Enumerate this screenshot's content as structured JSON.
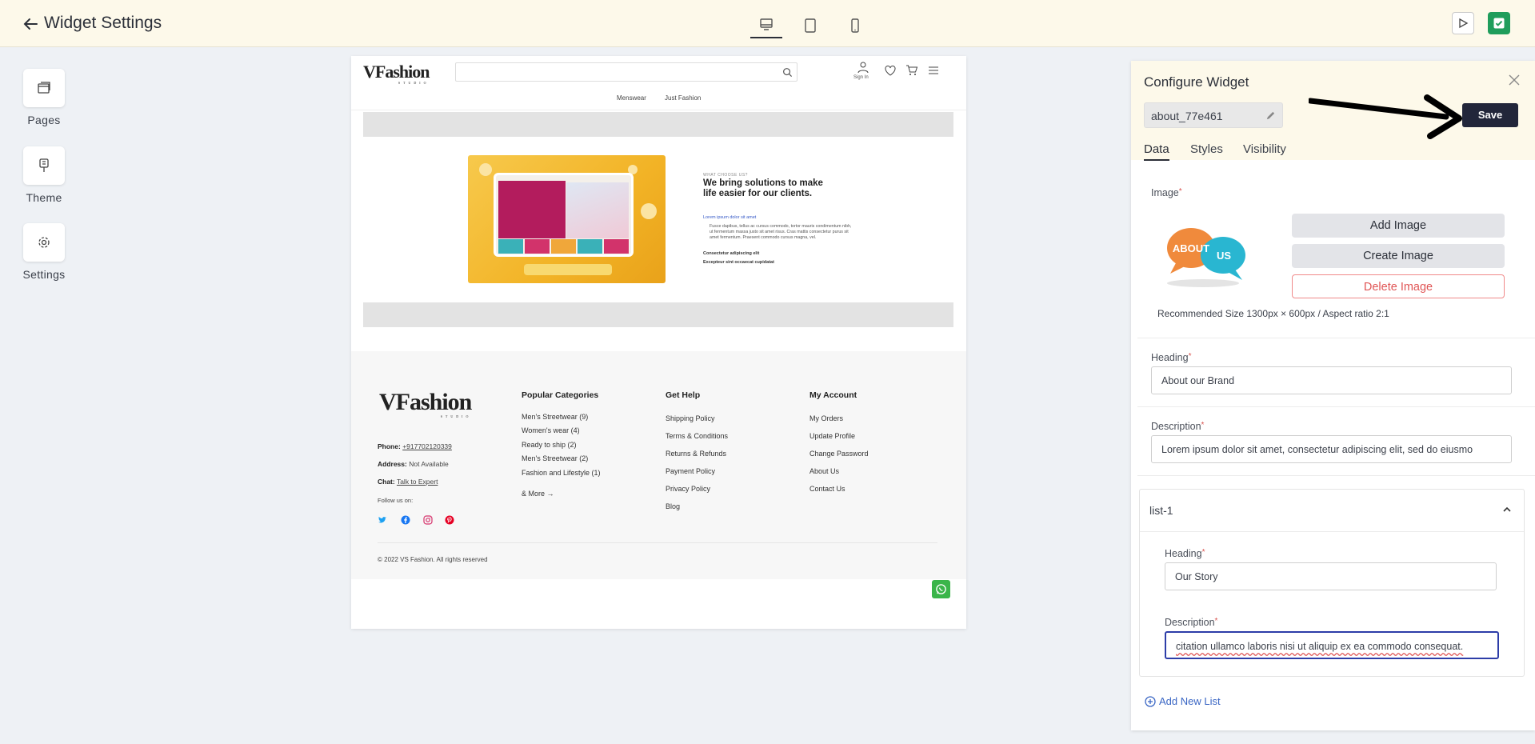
{
  "topbar": {
    "title": "Widget Settings",
    "devices": [
      "desktop-icon",
      "tablet-icon",
      "mobile-icon"
    ],
    "active_device": "desktop"
  },
  "rail": [
    {
      "label": "Pages",
      "icon": "pages-icon"
    },
    {
      "label": "Theme",
      "icon": "theme-icon"
    },
    {
      "label": "Settings",
      "icon": "gear-icon"
    }
  ],
  "preview": {
    "logo": "VFashion",
    "logo_sub": "STUDIO",
    "signin": "Sign In",
    "nav": [
      "Menswear",
      "Just Fashion"
    ],
    "about": {
      "eyebrow": "WHAT CHOOSE US?",
      "heading": "We bring solutions to make life easier for our clients.",
      "list1": "Lorem ipsum dolor sit amet",
      "para": "Fusce dapibus, tellus ac cursus commodo, tortor mauris condimentum nibh, ut fermentum massa justo sit amet risus. Cras mattis consectetur purus sit amet fermentum. Praesent commodo cursus magna, vel.",
      "list2": "Consectetur adipiscing elit",
      "list3": "Excepteur sint occaecat cupidatat"
    },
    "footer": {
      "phone_label": "Phone:",
      "phone": "+917702120339",
      "address_label": "Address:",
      "address": "Not Available",
      "chat_label": "Chat:",
      "chat": "Talk to Expert",
      "follow": "Follow us on:",
      "col1_title": "Popular Categories",
      "col1": [
        "Men's Streetwear (9)",
        "Women's wear (4)",
        "Ready to ship (2)",
        "Men's Streetwear (2)",
        "Fashion and Lifestyle (1)"
      ],
      "more": "& More",
      "col2_title": "Get Help",
      "col2": [
        "Shipping Policy",
        "Terms & Conditions",
        "Returns & Refunds",
        "Payment Policy",
        "Privacy Policy",
        "Blog"
      ],
      "col3_title": "My Account",
      "col3": [
        "My Orders",
        "Update Profile",
        "Change Password",
        "About Us",
        "Contact Us"
      ],
      "copyright": "© 2022 VS Fashion. All rights reserved"
    }
  },
  "panel": {
    "title": "Configure Widget",
    "widget_id": "about_77e461",
    "save": "Save",
    "tabs": [
      "Data",
      "Styles",
      "Visibility"
    ],
    "active_tab": "Data",
    "image_label": "Image",
    "image_text_1": "ABOUT",
    "image_text_2": "US",
    "add_image": "Add Image",
    "create_image": "Create Image",
    "delete_image": "Delete Image",
    "image_note": "Recommended Size 1300px × 600px / Aspect ratio 2:1",
    "heading_label": "Heading",
    "heading_value": "About our Brand",
    "description_label": "Description",
    "description_value": "Lorem ipsum dolor sit amet, consectetur adipiscing elit, sed do eiusmo",
    "list_title": "list-1",
    "list_heading_label": "Heading",
    "list_heading_value": "Our Story",
    "list_description_label": "Description",
    "list_description_value": "citation ullamco laboris nisi ut aliquip ex ea commodo consequat.",
    "add_list": "Add New List"
  },
  "colors": {
    "topbar_bg": "#fdf9ea",
    "save_bg": "#22263a",
    "check_btn": "#1f9d5b",
    "link_blue": "#3a66c4",
    "delete_red": "#e05555"
  }
}
